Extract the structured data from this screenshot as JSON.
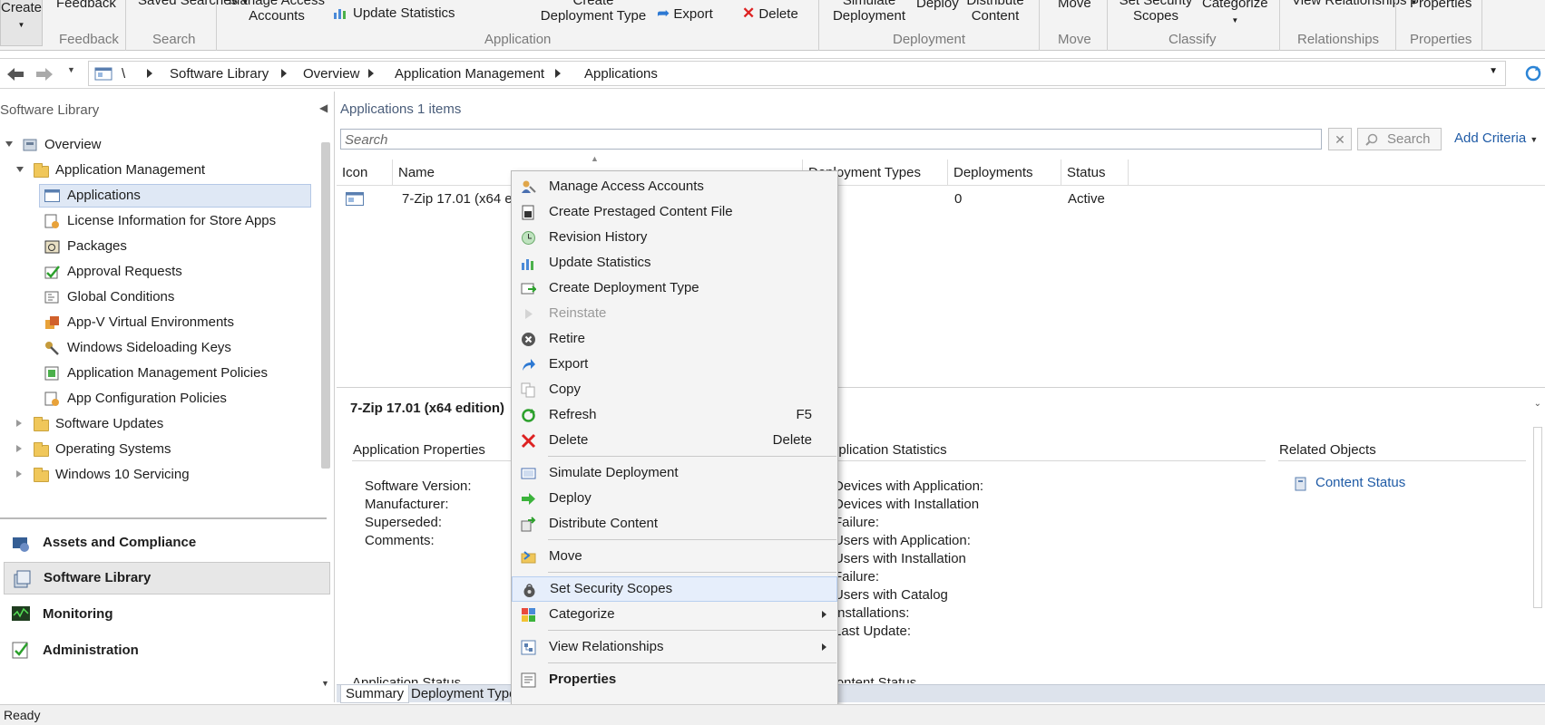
{
  "ribbon": {
    "create": "Create",
    "feedback_btn": "Feedback",
    "saved_searches": "Saved Searches",
    "manage_access": "Manage Access Accounts",
    "update_statistics": "Update Statistics",
    "create_deployment_type": "Create Deployment Type",
    "export": "Export",
    "delete": "Delete",
    "simulate_deployment": "Simulate Deployment",
    "deploy": "Deploy",
    "distribute_content": "Distribute Content",
    "move": "Move",
    "set_security_scopes": "Set Security Scopes",
    "categorize": "Categorize",
    "view_relationships": "View Relationships",
    "properties": "Properties",
    "groups": {
      "feedback": "Feedback",
      "search": "Search",
      "application": "Application",
      "deployment": "Deployment",
      "move": "Move",
      "classify": "Classify",
      "relationships": "Relationships",
      "properties": "Properties"
    }
  },
  "address": {
    "root": "\\",
    "crumbs": [
      "Software Library",
      "Overview",
      "Application Management",
      "Applications"
    ]
  },
  "nav": {
    "title": "Software Library",
    "overview": "Overview",
    "app_mgmt": "Application Management",
    "items": [
      "Applications",
      "License Information for Store Apps",
      "Packages",
      "Approval Requests",
      "Global Conditions",
      "App-V Virtual Environments",
      "Windows Sideloading Keys",
      "Application Management Policies",
      "App Configuration Policies"
    ],
    "folders": [
      "Software Updates",
      "Operating Systems",
      "Windows 10 Servicing"
    ],
    "workspaces": [
      "Assets and Compliance",
      "Software Library",
      "Monitoring",
      "Administration"
    ]
  },
  "content": {
    "heading": "Applications 1 items",
    "search_placeholder": "Search",
    "search_button": "Search",
    "add_criteria": "Add Criteria",
    "columns": [
      "Icon",
      "Name",
      "Deployment Types",
      "Deployments",
      "Status"
    ],
    "row": {
      "name": "7-Zip 17.01 (x64 edition)",
      "deployments": "0",
      "status": "Active"
    },
    "detail_title": "7-Zip 17.01 (x64 edition)",
    "app_props_header": "Application Properties",
    "app_props": [
      "Software Version:",
      "Manufacturer:",
      "Superseded:",
      "Comments:"
    ],
    "app_stats_header": "Application Statistics",
    "app_stats": [
      "Devices with Application:",
      "Devices with Installation",
      "Failure:",
      "Users with Application:",
      "Users with Installation",
      "Failure:",
      "Users with Catalog",
      "Installations:",
      "Last Update:"
    ],
    "related_header": "Related Objects",
    "content_status": "Content Status",
    "app_status_cut": "Application Status",
    "content_status_cut": "Content Status",
    "tabs": [
      "Summary",
      "Deployment Types"
    ]
  },
  "menu": {
    "items": [
      {
        "label": "Manage Access Accounts",
        "icon": "manage-access-icon"
      },
      {
        "label": "Create Prestaged Content File",
        "icon": "prestaged-content-icon"
      },
      {
        "label": "Revision History",
        "icon": "revision-history-icon"
      },
      {
        "label": "Update Statistics",
        "icon": "update-statistics-icon"
      },
      {
        "label": "Create Deployment Type",
        "icon": "create-deployment-type-icon"
      },
      {
        "label": "Reinstate",
        "icon": "reinstate-icon"
      },
      {
        "label": "Retire",
        "icon": "retire-icon"
      },
      {
        "label": "Export",
        "icon": "export-icon"
      },
      {
        "label": "Copy",
        "icon": "copy-icon"
      },
      {
        "label": "Refresh",
        "icon": "refresh-icon",
        "shortcut": "F5"
      },
      {
        "label": "Delete",
        "icon": "delete-icon",
        "shortcut": "Delete"
      },
      {
        "label": "Simulate Deployment",
        "icon": "simulate-deployment-icon"
      },
      {
        "label": "Deploy",
        "icon": "deploy-icon"
      },
      {
        "label": "Distribute Content",
        "icon": "distribute-content-icon"
      },
      {
        "label": "Move",
        "icon": "move-icon"
      },
      {
        "label": "Set Security Scopes",
        "icon": "security-scopes-icon"
      },
      {
        "label": "Categorize",
        "icon": "categorize-icon"
      },
      {
        "label": "View Relationships",
        "icon": "view-relationships-icon"
      },
      {
        "label": "Properties",
        "icon": "properties-icon"
      }
    ]
  },
  "status_bar": "Ready"
}
